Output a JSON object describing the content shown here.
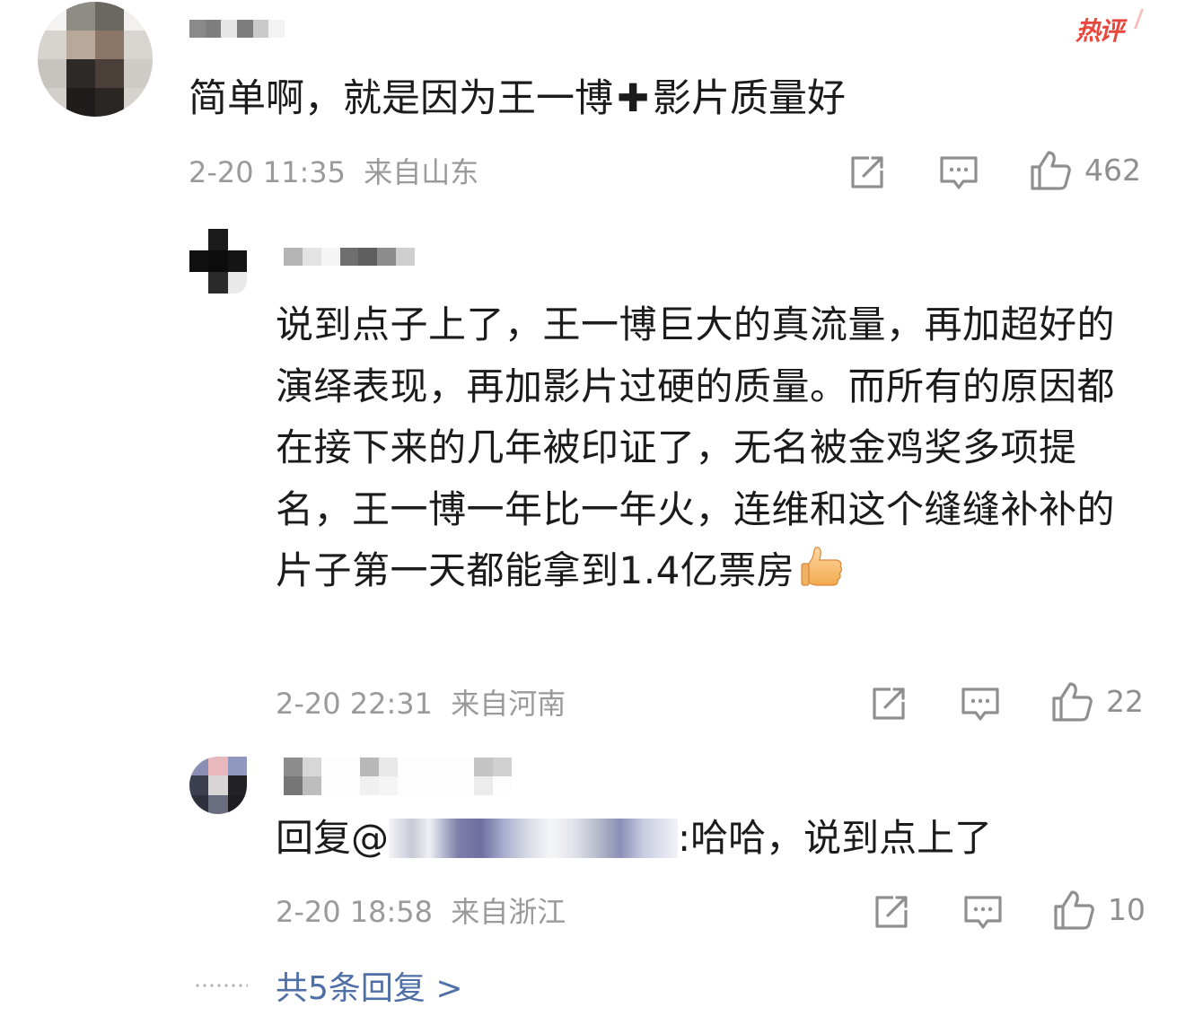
{
  "hot_badge": {
    "label": "热评",
    "color": "#e8473e"
  },
  "main_comment": {
    "text_before": "简单啊，就是因为王一博",
    "plus_symbol": "✚",
    "text_after": "影片质量好",
    "time": "2-20 11:35",
    "location": "来自山东",
    "likes": "462",
    "icons": [
      "share-icon",
      "comment-icon",
      "like-icon"
    ]
  },
  "replies": [
    {
      "text": "说到点子上了，王一博巨大的真流量，再加超好的演绎表现，再加影片过硬的质量。而所有的原因都在接下来的几年被印证了，无名被金鸡奖多项提名，王一博一年比一年火，连维和这个缝缝补补的片子第一天都能拿到1.4亿票房",
      "emoji": "thumbs-up-emoji",
      "time": "2-20 22:31",
      "location": "来自河南",
      "likes": "22"
    },
    {
      "reply_prefix": "回复@",
      "text": ":哈哈，说到点上了",
      "time": "2-20 18:58",
      "location": "来自浙江",
      "likes": "10"
    }
  ],
  "footer": {
    "more_replies": "共5条回复 >",
    "link_color": "#4f6fa7"
  }
}
